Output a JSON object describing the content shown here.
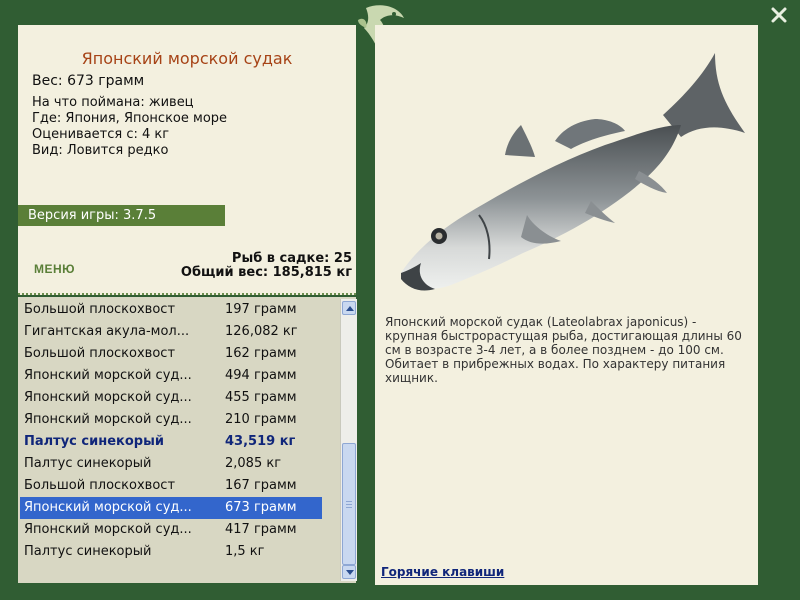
{
  "fish": {
    "title": "Японский морской судак",
    "weight": "Вес: 673 грамм",
    "info": {
      "bait": "На что поймана: живец",
      "where": "Где: Япония, Японское море",
      "rated": "Оценивается с: 4 кг",
      "kind": "Вид: Ловится редко"
    },
    "description": "Японский морской судак (Lateolabrax japonicus) - крупная быстрорастущая рыба, достигающая длины 60 см в возрасте 3-4 лет, а в более позднем - до 100 см. Обитает в прибрежных водах. По характеру питания хищник."
  },
  "version": "Версия игры: 3.7.5",
  "menu_label": "МЕНЮ",
  "stats": {
    "count": "Рыб в садке: 25",
    "total": "Общий вес: 185,815 кг"
  },
  "catch_list": [
    {
      "name": "Большой плоскохвост",
      "weight": "197 грамм",
      "style": "normal"
    },
    {
      "name": "Гигантская акула-мол...",
      "weight": "126,082 кг",
      "style": "normal"
    },
    {
      "name": "Большой плоскохвост",
      "weight": "162 грамм",
      "style": "normal"
    },
    {
      "name": "Японский морской суд...",
      "weight": "494 грамм",
      "style": "normal"
    },
    {
      "name": "Японский морской суд...",
      "weight": "455 грамм",
      "style": "normal"
    },
    {
      "name": "Японский морской суд...",
      "weight": "210 грамм",
      "style": "normal"
    },
    {
      "name": "Палтус синекорый",
      "weight": "43,519 кг",
      "style": "bold"
    },
    {
      "name": "Палтус синекорый",
      "weight": "2,085 кг",
      "style": "normal"
    },
    {
      "name": "Большой плоскохвост",
      "weight": "167 грамм",
      "style": "normal"
    },
    {
      "name": "Японский морской суд...",
      "weight": "673 грамм",
      "style": "selected"
    },
    {
      "name": "Японский морской суд...",
      "weight": "417 грамм",
      "style": "normal"
    },
    {
      "name": "Палтус синекорый",
      "weight": "1,5 кг",
      "style": "normal"
    }
  ],
  "hotkeys_label": "Горячие клавиши",
  "icons": {
    "close": "close-icon",
    "logo": "fish-logo-icon",
    "scroll_up": "scroll-up-arrow-icon",
    "scroll_down": "scroll-down-arrow-icon"
  },
  "colors": {
    "frame": "#305d33",
    "panel": "#f3f0df",
    "title": "#a64316",
    "accent_green": "#5a7f38",
    "selection": "#3366cc",
    "bold_item": "#10267a"
  }
}
